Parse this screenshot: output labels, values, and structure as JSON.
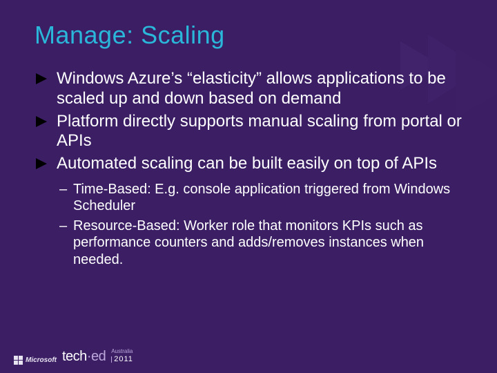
{
  "title": "Manage: Scaling",
  "bullets": [
    {
      "text": "Windows Azure’s “elasticity” allows applications to be scaled up and down based on demand"
    },
    {
      "text": "Platform directly supports manual scaling from portal or APIs"
    },
    {
      "text": "Automated scaling can be built easily on top of APIs"
    }
  ],
  "sub_bullets": [
    {
      "text": "Time-Based: E.g. console application triggered from Windows Scheduler"
    },
    {
      "text": "Resource-Based: Worker role that monitors KPIs such as performance counters and adds/removes instances when needed."
    }
  ],
  "footer": {
    "microsoft": "Microsoft",
    "brand_a": "tech",
    "brand_b": "·ed",
    "region": "Australia",
    "year": "2011"
  }
}
